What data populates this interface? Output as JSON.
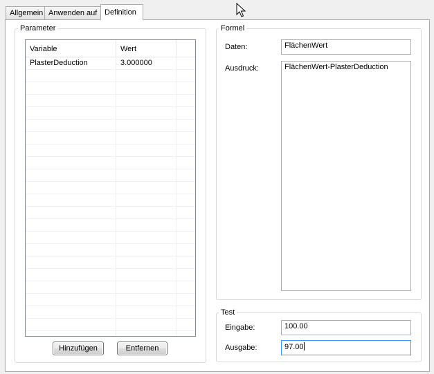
{
  "tabs": [
    {
      "label": "Allgemein"
    },
    {
      "label": "Anwenden auf"
    },
    {
      "label": "Definition"
    }
  ],
  "parameter": {
    "title": "Parameter",
    "columns": [
      "Variable",
      "Wert"
    ],
    "rows": [
      {
        "variable": "PlasterDeduction",
        "value": "3.000000"
      }
    ],
    "add_button": "Hinzufügen",
    "remove_button": "Entfernen"
  },
  "formel": {
    "title": "Formel",
    "daten_label": "Daten:",
    "daten_value": "FlächenWert",
    "ausdruck_label": "Ausdruck:",
    "ausdruck_value": "FlächenWert-PlasterDeduction"
  },
  "test": {
    "title": "Test",
    "eingabe_label": "Eingabe:",
    "eingabe_value": "100.00",
    "ausgabe_label": "Ausgabe:",
    "ausgabe_value": "97.00"
  },
  "icons": {
    "cursor": "mouse-pointer-icon"
  }
}
